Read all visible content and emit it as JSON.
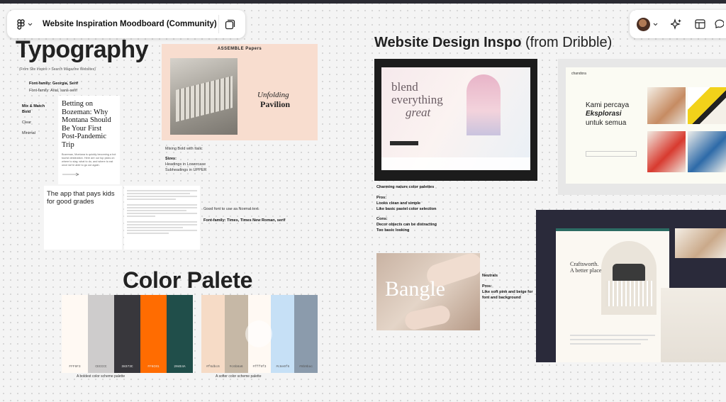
{
  "toolbar": {
    "file_title": "Website Inspiration Moodboard (Community)"
  },
  "typography": {
    "heading": "Typography",
    "source": "(From Site Inspire > Search Magazine Websites)",
    "font_serif": "Font-family: Georgia, Serif",
    "font_sans": "Font-family: Arial, sans-serif",
    "mix_match": "Mix & Match",
    "bold": "Bold",
    "clear": "Clear",
    "minimal": "Minimal",
    "article_headline": "Betting on Bozeman: Why Montana Should Be Your First Post-Pandemic Trip",
    "article_body": "Bozeman, Montana is quickly becoming a hot tourist destination. Here are our top picks on where to stay, what to do, and where to eat once we're able to go out again.",
    "card_text": "The app that pays kids for good grades",
    "assemble_brand": "ASSEMBLE Papers",
    "unfolding": "Unfolding",
    "pavilion": "Pavilion",
    "mixing_note": "Mixing Bold with Italic",
    "sizes_label": "Sizes:",
    "sizes_1": "Headings in Lowercase",
    "sizes_2": "Subheadings in UPPER",
    "good_font": "Good font to use as Normal text",
    "font_times": "Font-family: Times, Times New Roman, serif"
  },
  "design": {
    "heading_bold": "Website Design Inspo",
    "heading_light": " (from Dribble)",
    "blend_1": "blend",
    "blend_2": "everything",
    "blend_3": "great",
    "notes_title": "Charming nature color palettes",
    "pros": "Pros:",
    "pros_1": "Looks clean and simple",
    "pros_2": "Like basic pastel color selection",
    "cons": "Cons:",
    "cons_1": "Decor objects can be distracting",
    "cons_2": "Too basic looking",
    "chandora_brand": "chandora",
    "chandora_1": "Kami percaya",
    "chandora_2": "Eksplorasi",
    "chandora_3": "untuk semua",
    "bangle": "Bangle",
    "neutrals": "Neutrals",
    "neutrals_pros": "Pros:",
    "neutrals_1": "Like soft pink and beige for",
    "neutrals_2": "font and background",
    "craft_1": "Craftsworth.",
    "craft_2": "A better place"
  },
  "palette": {
    "heading": "Color Palete",
    "bold_caption": "A boldest color scheme palette",
    "soft_caption": "A softer color scheme palette",
    "bold_swatches": [
      {
        "hex": "#FFF9F3",
        "label": "FFF9F3"
      },
      {
        "hex": "#CECCCC",
        "label": "CECCCC"
      },
      {
        "hex": "#38373C",
        "label": "38373C"
      },
      {
        "hex": "#FF6C01",
        "label": "FF6C01"
      },
      {
        "hex": "#204E4A",
        "label": "204E4A"
      }
    ],
    "soft_swatches": [
      {
        "hex": "#F6DBC6",
        "label": "#f6dbc6"
      },
      {
        "hex": "#C6B8A6",
        "label": "#c6b8a6"
      },
      {
        "hex": "#FFF9F3",
        "label": "#fff9f3"
      },
      {
        "hex": "#C6E0F6",
        "label": "#c6e0f6"
      },
      {
        "hex": "#8B9BAC",
        "label": "#8b9bac"
      }
    ]
  }
}
